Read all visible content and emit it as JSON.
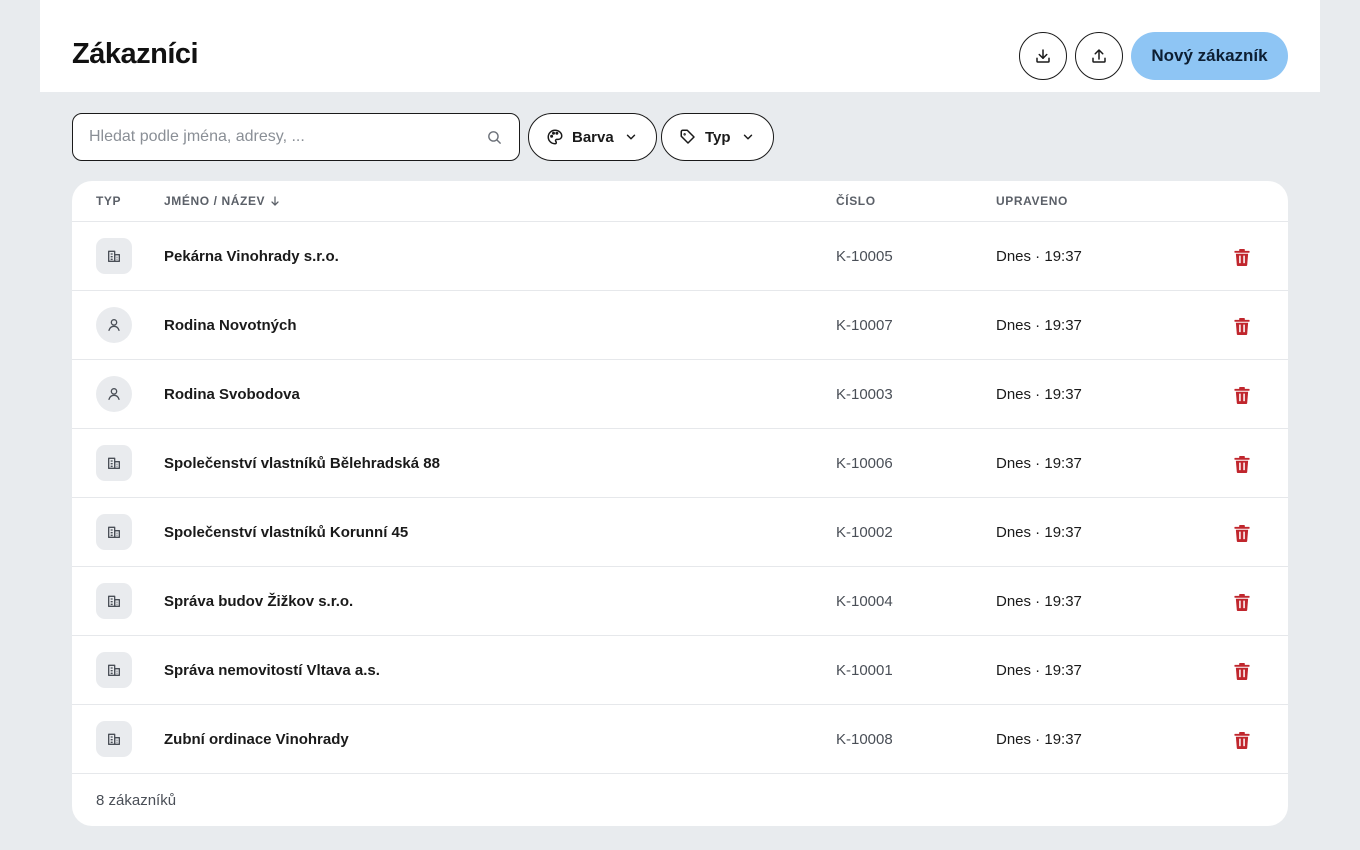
{
  "header": {
    "title": "Zákazníci",
    "download_icon": "download-icon",
    "upload_icon": "upload-icon",
    "new_button_label": "Nový zákazník",
    "accent_color": "#8ec5f4"
  },
  "toolbar": {
    "search_placeholder": "Hledat podle jména, adresy, ...",
    "search_value": "",
    "filter_color_label": "Barva",
    "filter_type_label": "Typ"
  },
  "table": {
    "columns": {
      "type": "TYP",
      "name": "JMÉNO / NÁZEV",
      "number": "ČÍSLO",
      "modified": "UPRAVENO"
    },
    "sort": {
      "column": "name",
      "direction": "desc-arrow"
    },
    "rows": [
      {
        "type": "company",
        "name": "Pekárna Vinohrady s.r.o.",
        "number": "K-10005",
        "modified": "Dnes · 19:37"
      },
      {
        "type": "person",
        "name": "Rodina Novotných",
        "number": "K-10007",
        "modified": "Dnes · 19:37"
      },
      {
        "type": "person",
        "name": "Rodina Svobodova",
        "number": "K-10003",
        "modified": "Dnes · 19:37"
      },
      {
        "type": "company",
        "name": "Společenství vlastníků Bělehradská 88",
        "number": "K-10006",
        "modified": "Dnes · 19:37"
      },
      {
        "type": "company",
        "name": "Společenství vlastníků Korunní 45",
        "number": "K-10002",
        "modified": "Dnes · 19:37"
      },
      {
        "type": "company",
        "name": "Správa budov Žižkov s.r.o.",
        "number": "K-10004",
        "modified": "Dnes · 19:37"
      },
      {
        "type": "company",
        "name": "Správa nemovitostí Vltava a.s.",
        "number": "K-10001",
        "modified": "Dnes · 19:37"
      },
      {
        "type": "company",
        "name": "Zubní ordinace Vinohrady",
        "number": "K-10008",
        "modified": "Dnes · 19:37"
      }
    ],
    "delete_color": "#c0262d"
  },
  "footer": {
    "count_label": "8 zákazníků"
  }
}
